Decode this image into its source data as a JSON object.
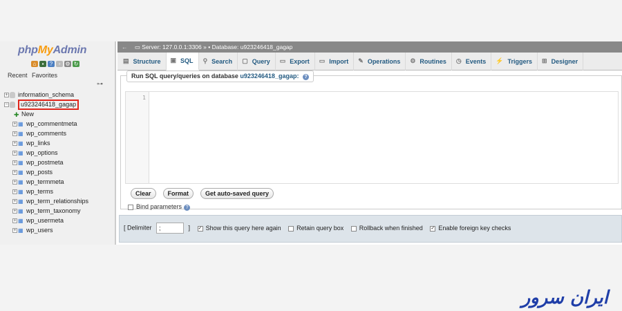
{
  "logo": {
    "part1": "php",
    "part2": "My",
    "part3": "Admin"
  },
  "nav": {
    "recent": "Recent",
    "favorites": "Favorites",
    "databases": [
      {
        "name": "information_schema"
      },
      {
        "name": "u923246418_gagap"
      }
    ],
    "new_label": "New",
    "tables": [
      "wp_commentmeta",
      "wp_comments",
      "wp_links",
      "wp_options",
      "wp_postmeta",
      "wp_posts",
      "wp_termmeta",
      "wp_terms",
      "wp_term_relationships",
      "wp_term_taxonomy",
      "wp_usermeta",
      "wp_users"
    ]
  },
  "breadcrumb": {
    "server": "Server: 127.0.0.1:3306",
    "sep": "»",
    "database": "Database: u923246418_gagap"
  },
  "tabs": [
    {
      "label": "Structure",
      "icon": "structure-icon"
    },
    {
      "label": "SQL",
      "icon": "sql-icon",
      "active": true
    },
    {
      "label": "Search",
      "icon": "search-icon"
    },
    {
      "label": "Query",
      "icon": "query-icon"
    },
    {
      "label": "Export",
      "icon": "export-icon"
    },
    {
      "label": "Import",
      "icon": "import-icon"
    },
    {
      "label": "Operations",
      "icon": "operations-icon"
    },
    {
      "label": "Routines",
      "icon": "routines-icon"
    },
    {
      "label": "Events",
      "icon": "events-icon"
    },
    {
      "label": "Triggers",
      "icon": "triggers-icon"
    },
    {
      "label": "Designer",
      "icon": "designer-icon"
    }
  ],
  "sql_panel": {
    "legend_prefix": "Run SQL query/queries on database",
    "legend_db": "u923246418_gagap:",
    "line_number": "1",
    "buttons": {
      "clear": "Clear",
      "format": "Format",
      "autosaved": "Get auto-saved query"
    },
    "bind_params": "Bind parameters"
  },
  "options": {
    "delimiter_label_open": "[ Delimiter",
    "delimiter_value": ";",
    "delimiter_label_close": "]",
    "show_query": "Show this query here again",
    "retain_box": "Retain query box",
    "rollback": "Rollback when finished",
    "foreign_keys": "Enable foreign key checks",
    "checked": {
      "show_query": true,
      "retain_box": false,
      "rollback": false,
      "foreign_keys": true
    }
  },
  "watermark": "ایران سرور",
  "colors": {
    "highlight": "#e0251b",
    "link": "#235a81",
    "brand": "#1f3ea8"
  }
}
